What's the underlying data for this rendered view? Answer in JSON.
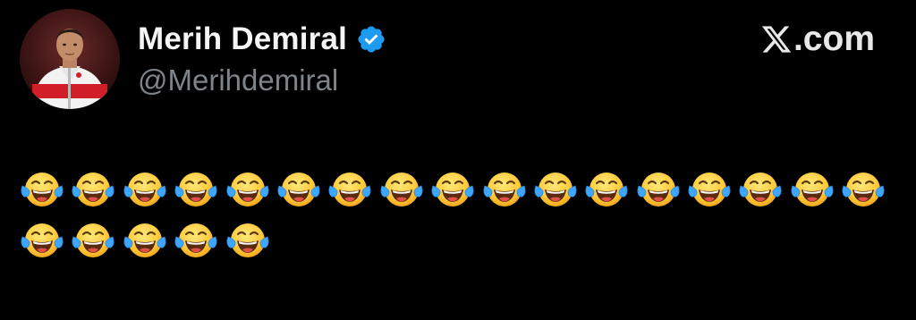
{
  "tweet": {
    "author": {
      "display_name": "Merih Demiral",
      "handle": "@Merihdemiral",
      "verified": true,
      "verified_color": "#1d9bf0"
    },
    "brand": {
      "label": ".com",
      "logo_icon": "x-logo-icon"
    },
    "body": {
      "emoji": "face-with-tears-of-joy-icon",
      "rows": [
        17,
        5
      ]
    }
  }
}
